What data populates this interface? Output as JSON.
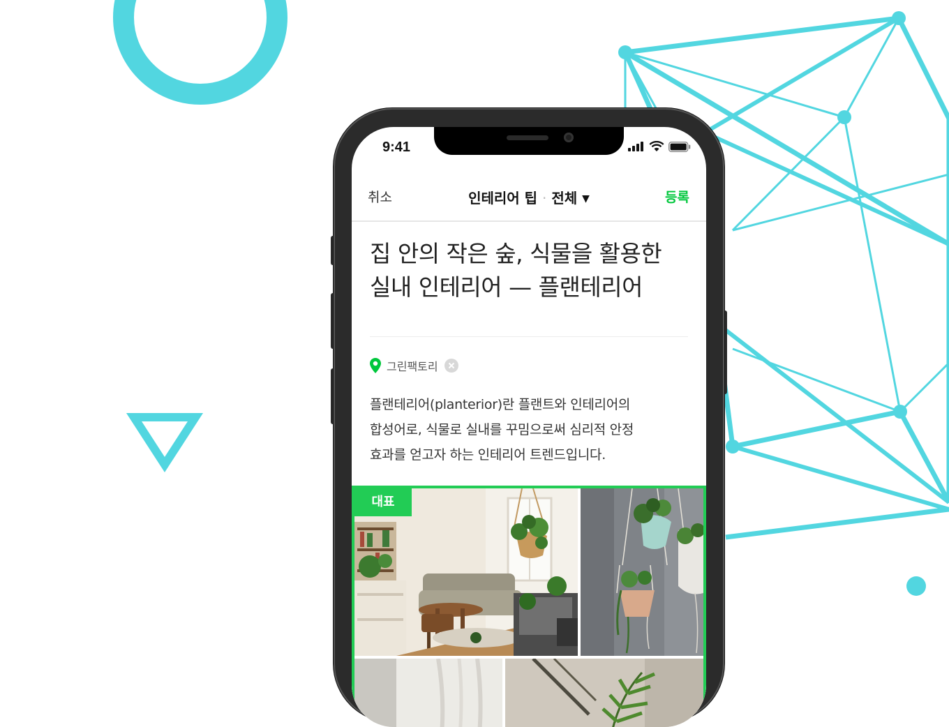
{
  "status_bar": {
    "time": "9:41"
  },
  "nav": {
    "cancel_label": "취소",
    "category": "인테리어 팁",
    "separator": "·",
    "filter": "전체",
    "caret": "▼",
    "submit_label": "등록"
  },
  "article": {
    "title_line1": "집 안의 작은 숲, 식물을 활용한",
    "title_line2": "실내 인테리어 — 플랜테리어",
    "location": "그린팩토리",
    "body_line1": "플랜테리어(planterior)란 플랜트와 인테리어의",
    "body_line2": "합성어로, 식물로 실내를 꾸밈으로써 심리적 안정",
    "body_line3": "효과를 얻고자 하는 인테리어 트렌드입니다."
  },
  "gallery": {
    "badge": "대표",
    "photos": [
      {
        "name": "living-room-photo"
      },
      {
        "name": "hanging-plants-photo"
      },
      {
        "name": "curtain-photo"
      },
      {
        "name": "palm-leaves-photo"
      }
    ]
  },
  "colors": {
    "accent": "#00c73c",
    "gallery_border": "#22cc55",
    "decoration": "#52d6e0"
  },
  "icons": [
    "signal-icon",
    "wifi-icon",
    "battery-icon",
    "caret-down-icon",
    "location-pin-icon",
    "clear-icon"
  ]
}
